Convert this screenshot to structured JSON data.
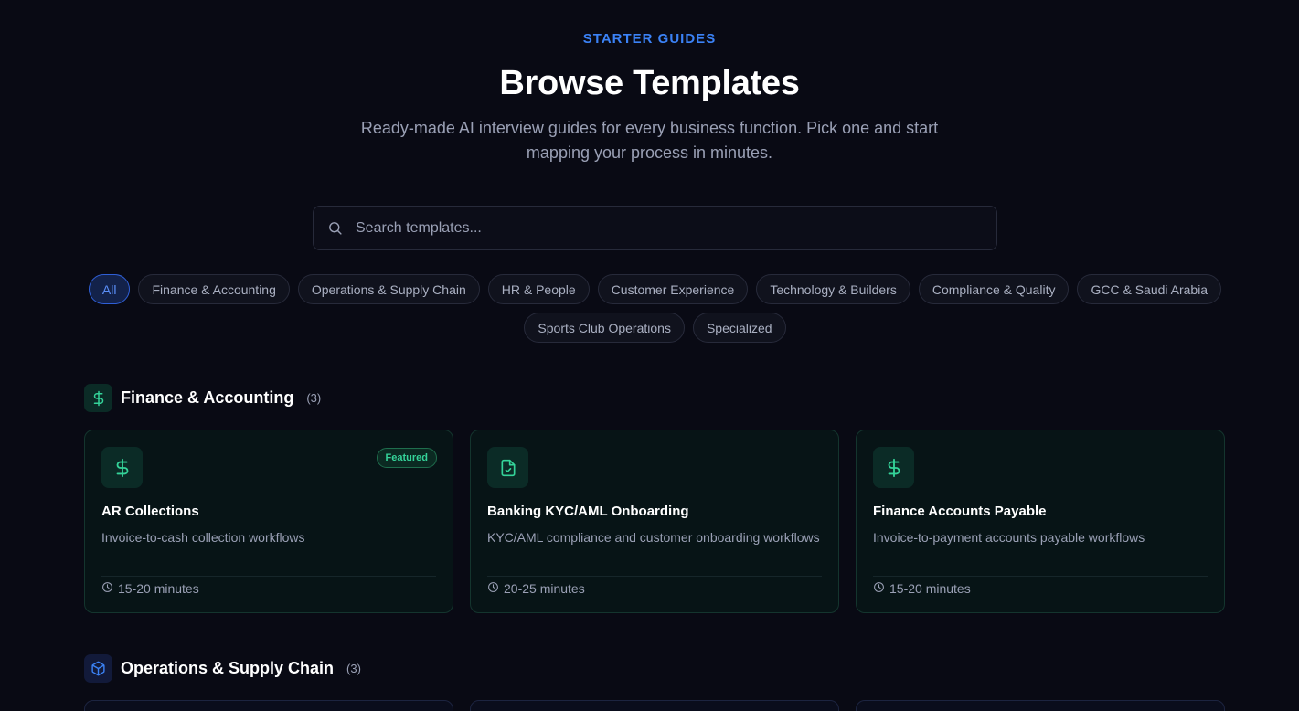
{
  "header": {
    "eyebrow": "STARTER GUIDES",
    "title": "Browse Templates",
    "subtitle": "Ready-made AI interview guides for every business function. Pick one and start mapping your process in minutes."
  },
  "search": {
    "placeholder": "Search templates...",
    "value": ""
  },
  "filters": [
    "All",
    "Finance & Accounting",
    "Operations & Supply Chain",
    "HR & People",
    "Customer Experience",
    "Technology & Builders",
    "Compliance & Quality",
    "GCC & Saudi Arabia",
    "Sports Club Operations",
    "Specialized"
  ],
  "active_filter": "All",
  "sections": [
    {
      "name": "Finance & Accounting",
      "count": "(3)",
      "icon": "dollar-icon",
      "color": "#34d399",
      "cards": [
        {
          "title": "AR Collections",
          "description": "Invoice-to-cash collection workflows",
          "time": "15-20 minutes",
          "badge": "Featured",
          "icon": "dollar-icon"
        },
        {
          "title": "Banking KYC/AML Onboarding",
          "description": "KYC/AML compliance and customer onboarding workflows",
          "time": "20-25 minutes",
          "badge": "",
          "icon": "file-check-icon"
        },
        {
          "title": "Finance Accounts Payable",
          "description": "Invoice-to-payment accounts payable workflows",
          "time": "15-20 minutes",
          "badge": "",
          "icon": "dollar-icon"
        }
      ]
    },
    {
      "name": "Operations & Supply Chain",
      "count": "(3)",
      "icon": "box-icon",
      "color": "#3b82f6",
      "cards": []
    }
  ],
  "colors": {
    "accent_blue": "#3b82f6",
    "accent_green": "#34d399",
    "background": "#090a14"
  }
}
